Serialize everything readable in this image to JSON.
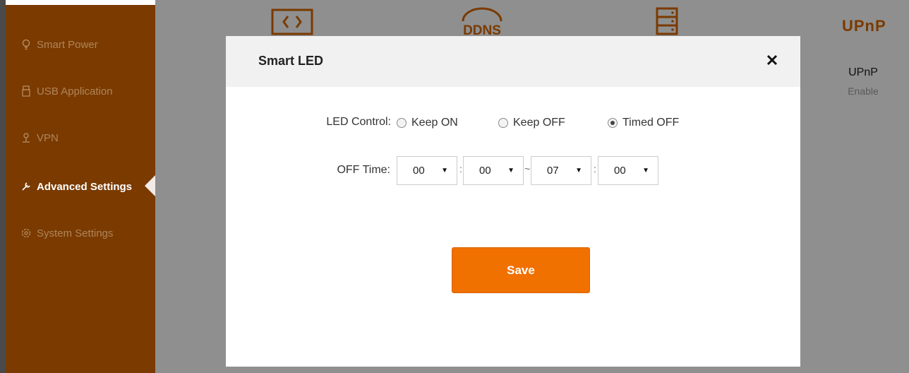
{
  "sidebar": {
    "items": [
      {
        "label": "Smart Power",
        "icon": "lightbulb-icon"
      },
      {
        "label": "USB Application",
        "icon": "usb-icon"
      },
      {
        "label": "VPN",
        "icon": "vpn-icon"
      },
      {
        "label": "Advanced Settings",
        "icon": "wrench-icon",
        "active": true
      },
      {
        "label": "System Settings",
        "icon": "gear-icon"
      }
    ]
  },
  "background": {
    "icons": [
      "code-icon",
      "ddns-icon",
      "server-icon",
      "upnp-logo-icon"
    ],
    "ddns_text": "DDNS",
    "upnp": {
      "logo": "UPnP",
      "title": "UPnP",
      "status": "Enable"
    }
  },
  "modal": {
    "title": "Smart LED",
    "close_icon": "close-icon",
    "led_control": {
      "label": "LED Control:",
      "options": [
        {
          "label": "Keep ON",
          "selected": false
        },
        {
          "label": "Keep OFF",
          "selected": false
        },
        {
          "label": "Timed OFF",
          "selected": true
        }
      ]
    },
    "off_time": {
      "label": "OFF Time:",
      "start_hour": "00",
      "start_minute": "00",
      "range_separator": "~",
      "end_hour": "07",
      "end_minute": "00",
      "time_separator": ":"
    },
    "save_label": "Save"
  },
  "colors": {
    "sidebar_bg": "#7a3a00",
    "overlay_bg": "#8f8f8f",
    "accent": "#f07000"
  }
}
